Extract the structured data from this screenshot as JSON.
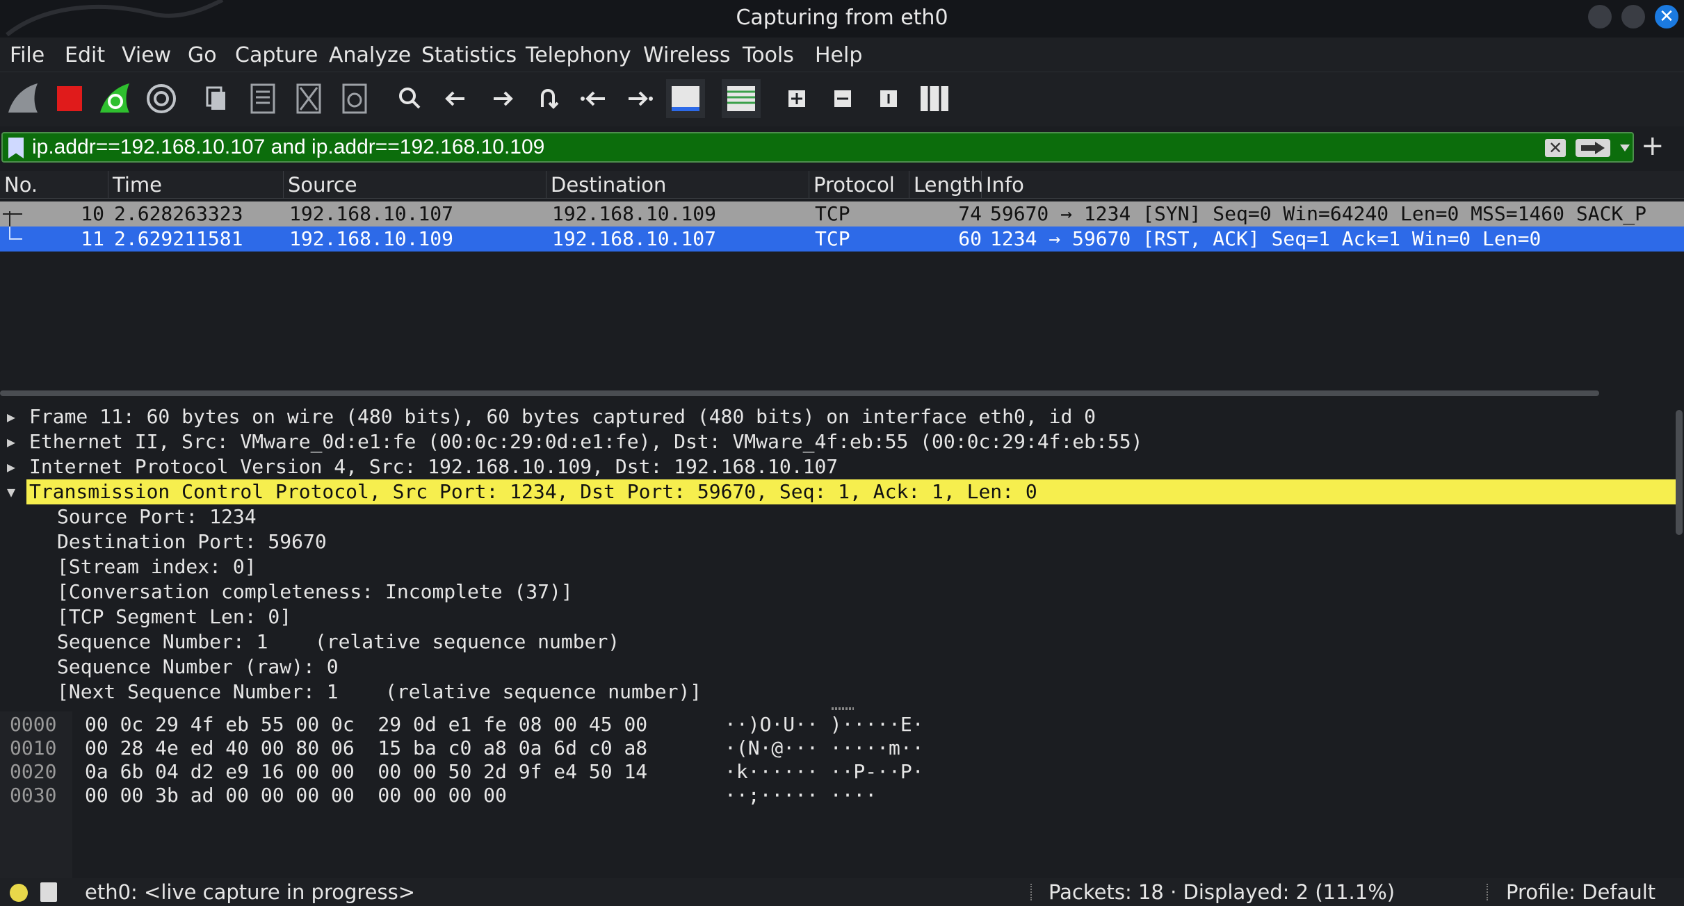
{
  "window": {
    "title": "Capturing from eth0"
  },
  "menu": [
    "File",
    "Edit",
    "View",
    "Go",
    "Capture",
    "Analyze",
    "Statistics",
    "Telephony",
    "Wireless",
    "Tools",
    "Help"
  ],
  "filter": {
    "value": "ip.addr==192.168.10.107 and ip.addr==192.168.10.109"
  },
  "packet_list": {
    "columns": [
      "No.",
      "Time",
      "Source",
      "Destination",
      "Protocol",
      "Length",
      "Info"
    ],
    "rows": [
      {
        "no": "10",
        "time": "2.628263323",
        "source": "192.168.10.107",
        "destination": "192.168.10.109",
        "protocol": "TCP",
        "length": "74",
        "info": "59670 → 1234 [SYN] Seq=0 Win=64240 Len=0 MSS=1460 SACK_P"
      },
      {
        "no": "11",
        "time": "2.629211581",
        "source": "192.168.10.109",
        "destination": "192.168.10.107",
        "protocol": "TCP",
        "length": "60",
        "info": "1234 → 59670 [RST, ACK] Seq=1 Ack=1 Win=0 Len=0"
      }
    ]
  },
  "details": {
    "frame": "Frame 11: 60 bytes on wire (480 bits), 60 bytes captured (480 bits) on interface eth0, id 0",
    "ethernet": "Ethernet II, Src: VMware_0d:e1:fe (00:0c:29:0d:e1:fe), Dst: VMware_4f:eb:55 (00:0c:29:4f:eb:55)",
    "ip": "Internet Protocol Version 4, Src: 192.168.10.109, Dst: 192.168.10.107",
    "tcp": "Transmission Control Protocol, Src Port: 1234, Dst Port: 59670, Seq: 1, Ack: 1, Len: 0",
    "tcp_fields": [
      "Source Port: 1234",
      "Destination Port: 59670",
      "[Stream index: 0]",
      "[Conversation completeness: Incomplete (37)]",
      "[TCP Segment Len: 0]",
      "Sequence Number: 1    (relative sequence number)",
      "Sequence Number (raw): 0",
      "[Next Sequence Number: 1    (relative sequence number)]"
    ]
  },
  "bytes": [
    {
      "offset": "0000",
      "hex": "00 0c 29 4f eb 55 00 0c  29 0d e1 fe 08 00 45 00",
      "ascii": "··)O·U·· )·····E·"
    },
    {
      "offset": "0010",
      "hex": "00 28 4e ed 40 00 80 06  15 ba c0 a8 0a 6d c0 a8",
      "ascii": "·(N·@··· ·····m··"
    },
    {
      "offset": "0020",
      "hex": "0a 6b 04 d2 e9 16 00 00  00 00 50 2d 9f e4 50 14",
      "ascii": "·k······ ··P-··P·"
    },
    {
      "offset": "0030",
      "hex": "00 00 3b ad 00 00 00 00  00 00 00 00",
      "ascii": "··;····· ····"
    }
  ],
  "status": {
    "interface": "eth0: <live capture in progress>",
    "packets": "Packets: 18 · Displayed: 2 (11.1%)",
    "profile": "Profile: Default"
  }
}
